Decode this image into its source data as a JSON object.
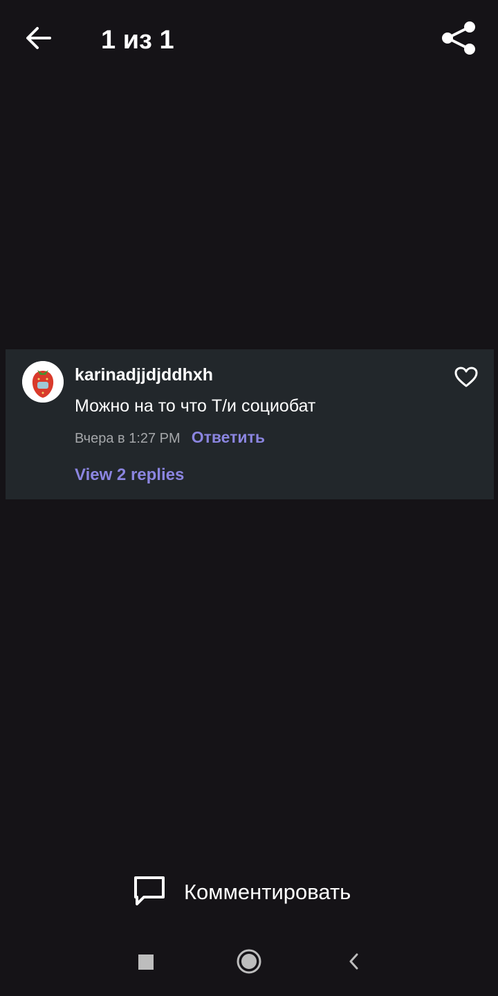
{
  "header": {
    "title": "1 из 1",
    "back_icon": "arrow-left-icon",
    "share_icon": "share-icon"
  },
  "comment": {
    "username": "karinadjjdjddhxh",
    "text": "Можно на то что Т/и социобат",
    "timestamp": "Вчера в 1:27 PM",
    "reply_label": "Ответить",
    "view_replies_label": "View 2 replies",
    "avatar_icon": "strawberry-avatar",
    "like_icon": "heart-outline-icon"
  },
  "composer": {
    "label": "Комментировать",
    "icon": "chat-bubble-icon"
  },
  "nav": {
    "recents_icon": "square-icon",
    "home_icon": "circle-icon",
    "back_icon": "chevron-left-icon"
  },
  "colors": {
    "background": "#151317",
    "card": "#22272b",
    "accent": "#8b85e0",
    "muted": "#a5a7aa"
  }
}
